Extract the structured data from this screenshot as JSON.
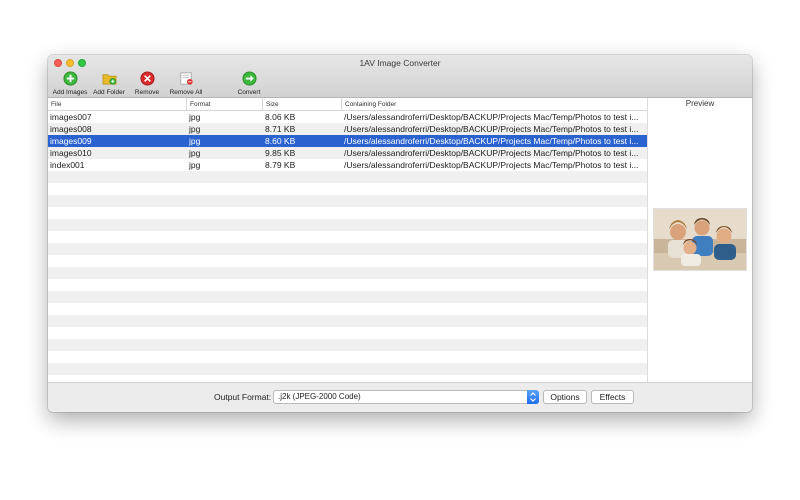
{
  "window": {
    "title": "1AV Image Converter"
  },
  "toolbar": {
    "add_images": "Add Images",
    "add_folder": "Add Folder",
    "remove": "Remove",
    "remove_all": "Remove All",
    "convert": "Convert"
  },
  "table": {
    "columns": [
      "File",
      "Format",
      "Size",
      "Containing Folder"
    ],
    "rows": [
      {
        "file": "images007",
        "format": "jpg",
        "size": "8.06 KB",
        "folder": "/Users/alessandroferri/Desktop/BACKUP/Projects Mac/Temp/Photos to test i...",
        "selected": false
      },
      {
        "file": "images008",
        "format": "jpg",
        "size": "8.71 KB",
        "folder": "/Users/alessandroferri/Desktop/BACKUP/Projects Mac/Temp/Photos to test i...",
        "selected": false
      },
      {
        "file": "images009",
        "format": "jpg",
        "size": "8.60 KB",
        "folder": "/Users/alessandroferri/Desktop/BACKUP/Projects Mac/Temp/Photos to test i...",
        "selected": true
      },
      {
        "file": "images010",
        "format": "jpg",
        "size": "9.85 KB",
        "folder": "/Users/alessandroferri/Desktop/BACKUP/Projects Mac/Temp/Photos to test i...",
        "selected": false
      },
      {
        "file": "index001",
        "format": "jpg",
        "size": "8.79 KB",
        "folder": "/Users/alessandroferri/Desktop/BACKUP/Projects Mac/Temp/Photos to test i...",
        "selected": false
      }
    ]
  },
  "preview": {
    "title": "Preview"
  },
  "output": {
    "label": "Output Format:",
    "selected": ".j2k (JPEG-2000 Code)",
    "options_button": "Options",
    "effects_button": "Effects"
  },
  "colors": {
    "selection": "#2a63cf",
    "add_icon": "#3cb83c",
    "remove_icon": "#d92b2b",
    "folder_icon": "#e8b92b"
  }
}
